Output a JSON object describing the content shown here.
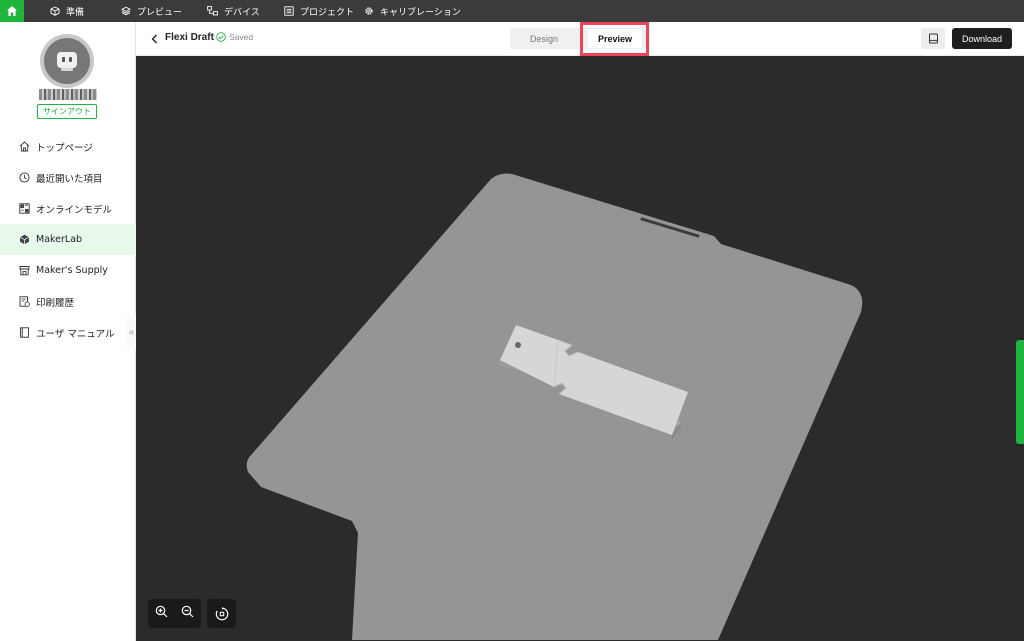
{
  "topbar": {
    "menu": [
      {
        "label": "準備",
        "icon": "box-icon"
      },
      {
        "label": "プレビュー",
        "icon": "layers-icon"
      },
      {
        "label": "デバイス",
        "icon": "devices-icon"
      },
      {
        "label": "プロジェクト",
        "icon": "list-icon"
      },
      {
        "label": "キャリブレーション",
        "icon": "gear-icon"
      }
    ]
  },
  "sidebar": {
    "signout_label": "サインアウト",
    "items": [
      {
        "label": "トップページ",
        "icon": "home-icon"
      },
      {
        "label": "最近開いた項目",
        "icon": "clock-icon"
      },
      {
        "label": "オンラインモデル",
        "icon": "models-icon"
      },
      {
        "label": "MakerLab",
        "icon": "cube-icon",
        "active": true
      },
      {
        "label": "Maker's Supply",
        "icon": "store-icon"
      },
      {
        "label": "印刷履歴",
        "icon": "history-icon"
      },
      {
        "label": "ユーザ マニュアル",
        "icon": "book-icon"
      }
    ],
    "collapse_glyph": "«"
  },
  "header": {
    "title": "Flexi Draft",
    "saved_label": "Saved",
    "tabs": {
      "design": "Design",
      "preview": "Preview"
    },
    "active_tab": "preview",
    "download_label": "Download"
  },
  "colors": {
    "brand_green": "#1fb53d",
    "highlight_red": "#ee4455",
    "viewport_bg": "#2b2b2b",
    "plate": "#959595",
    "model": "#d6d6d6"
  }
}
